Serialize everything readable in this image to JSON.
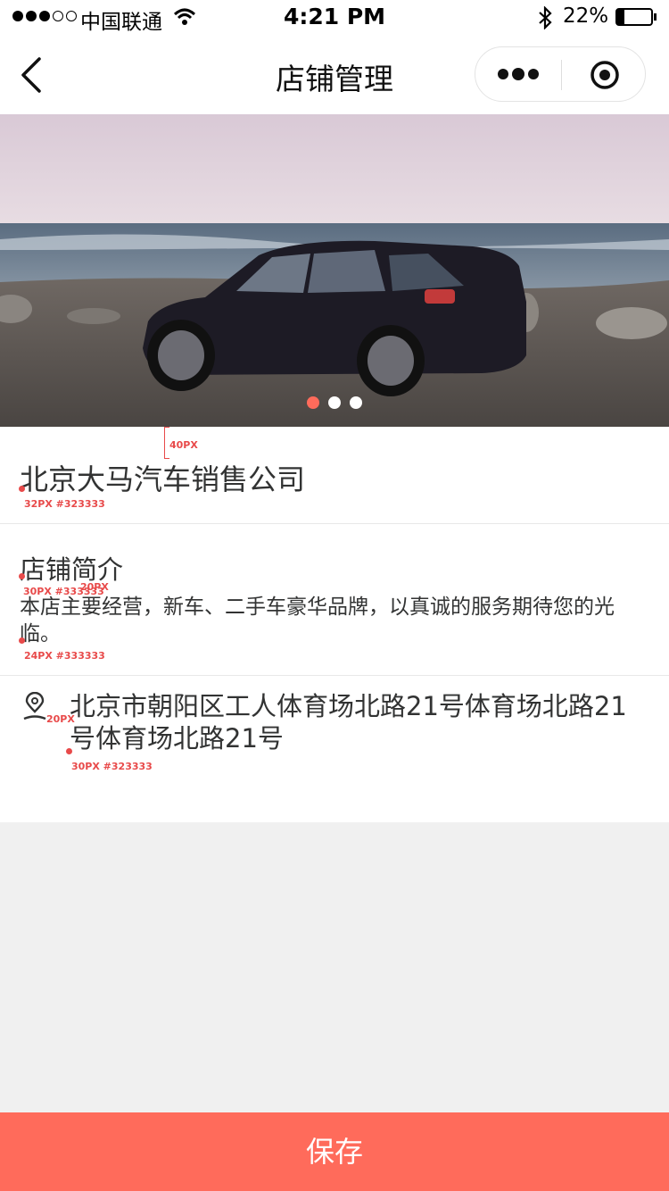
{
  "status_bar": {
    "carrier": "中国联通",
    "time": "4:21 PM",
    "battery": "22%",
    "signal_dots": [
      true,
      true,
      true,
      false,
      false
    ],
    "icons": [
      "wifi-icon",
      "bluetooth-icon",
      "battery-icon"
    ],
    "battery_level": 0.22
  },
  "nav": {
    "title": "店铺管理",
    "back_icon": "back-arrow-icon",
    "more_icon": "more-dots-icon",
    "close_icon": "target-circle-icon"
  },
  "banner": {
    "image": "black hatchback car parked on a beach at dusk",
    "pager_active_index": 0,
    "pager_count": 3,
    "active_color": "#ff6b5b"
  },
  "store": {
    "name": "北京大马汽车销售公司"
  },
  "intro": {
    "heading": "店铺简介",
    "text_line1": "本店主要经营，新车、二手车豪华品牌，以真诚的服务期待您的光",
    "text_line2": "临。"
  },
  "address": {
    "icon": "location-pin-icon",
    "line1": "北京市朝阳区工人体育场北路21号体育场北路21",
    "line2": "号体育场北路21号"
  },
  "annotations": {
    "spacing_40": "40PX",
    "name_spec": "32PX #323333",
    "heading_spec": "30PX #333333",
    "spacing_20a": "20PX",
    "intro_spec": "24PX #333333",
    "spacing_20b": "20PX",
    "address_spec": "30PX #323333"
  },
  "actions": {
    "save_label": "保存"
  },
  "colors": {
    "accent": "#ff6b5b",
    "text": "#323333",
    "annotation": "#e84a4a",
    "page_bg": "#f0f0f0"
  }
}
